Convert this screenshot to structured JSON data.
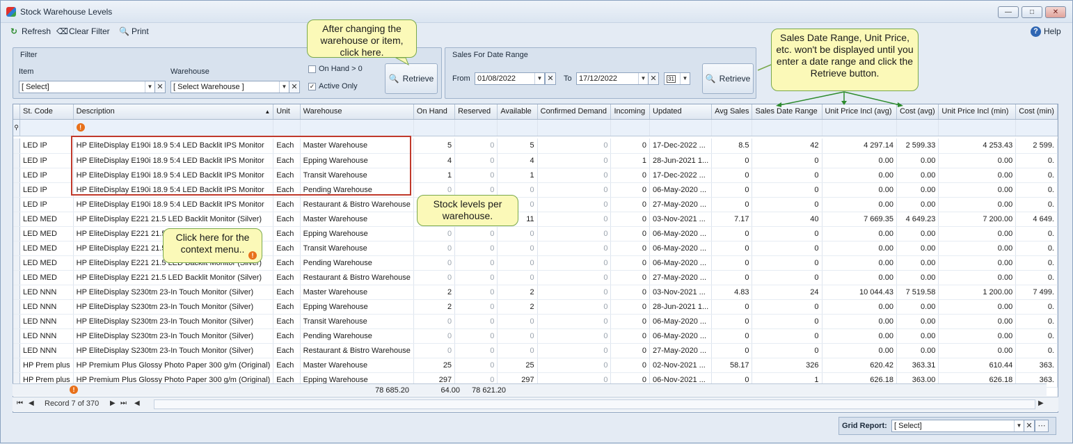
{
  "window": {
    "title": "Stock Warehouse Levels"
  },
  "toolbar": {
    "refresh": "Refresh",
    "clear_filter": "Clear Filter",
    "print": "Print",
    "help": "Help"
  },
  "filter": {
    "title": "Filter",
    "item_label": "Item",
    "item_value": "[ Select]",
    "warehouse_label": "Warehouse",
    "warehouse_value": "[ Select Warehouse ]",
    "on_hand_label": "On Hand > 0",
    "on_hand_checked": false,
    "active_only_label": "Active Only",
    "active_only_checked": true,
    "retrieve": "Retrieve"
  },
  "sales": {
    "title": "Sales For Date Range",
    "from_label": "From",
    "from_value": "01/08/2022",
    "to_label": "To",
    "to_value": "17/12/2022",
    "calendar_label": "31",
    "retrieve": "Retrieve"
  },
  "callouts": {
    "retrieve_hint": "After changing the warehouse or item, click here.",
    "date_hint": "Sales Date Range, Unit Price, etc. won't be displayed until you enter a date range and click the Retrieve button.",
    "stock_hint": "Stock levels per warehouse.",
    "context_hint": "Click here for the context menu.."
  },
  "grid": {
    "columns": [
      "St. Code",
      "Description",
      "Unit",
      "Warehouse",
      "On Hand",
      "Reserved",
      "Available",
      "Confirmed Demand",
      "Incoming",
      "Updated",
      "Avg Sales",
      "Sales Date Range",
      "Unit Price Incl (avg)",
      "Cost (avg)",
      "Unit Price Incl (min)",
      "Cost (min)"
    ],
    "rows": [
      [
        "LED IP",
        "HP EliteDisplay E190i 18.9 5:4 LED Backlit IPS Monitor",
        "Each",
        "Master Warehouse",
        "5",
        "0",
        "5",
        "0",
        "0",
        "17-Dec-2022 ...",
        "8.5",
        "42",
        "4 297.14",
        "2 599.33",
        "4 253.43",
        "2 599."
      ],
      [
        "LED IP",
        "HP EliteDisplay E190i 18.9 5:4 LED Backlit IPS Monitor",
        "Each",
        "Epping Warehouse",
        "4",
        "0",
        "4",
        "0",
        "1",
        "28-Jun-2021 1...",
        "0",
        "0",
        "0.00",
        "0.00",
        "0.00",
        "0."
      ],
      [
        "LED IP",
        "HP EliteDisplay E190i 18.9 5:4 LED Backlit IPS Monitor",
        "Each",
        "Transit Warehouse",
        "1",
        "0",
        "1",
        "0",
        "0",
        "17-Dec-2022 ...",
        "0",
        "0",
        "0.00",
        "0.00",
        "0.00",
        "0."
      ],
      [
        "LED IP",
        "HP EliteDisplay E190i 18.9 5:4 LED Backlit IPS Monitor",
        "Each",
        "Pending Warehouse",
        "0",
        "0",
        "0",
        "0",
        "0",
        "06-May-2020 ...",
        "0",
        "0",
        "0.00",
        "0.00",
        "0.00",
        "0."
      ],
      [
        "LED IP",
        "HP EliteDisplay E190i 18.9 5:4 LED Backlit IPS Monitor",
        "Each",
        "Restaurant & Bistro Warehouse",
        "0",
        "0",
        "0",
        "0",
        "0",
        "27-May-2020 ...",
        "0",
        "0",
        "0.00",
        "0.00",
        "0.00",
        "0."
      ],
      [
        "LED MED",
        "HP EliteDisplay E221 21.5 LED Backlit Monitor (Silver)",
        "Each",
        "Master Warehouse",
        "11",
        "0",
        "11",
        "0",
        "0",
        "03-Nov-2021 ...",
        "7.17",
        "40",
        "7 669.35",
        "4 649.23",
        "7 200.00",
        "4 649."
      ],
      [
        "LED MED",
        "HP EliteDisplay E221 21.5 LED Backlit Monitor (Silver)",
        "Each",
        "Epping Warehouse",
        "0",
        "0",
        "0",
        "0",
        "0",
        "06-May-2020 ...",
        "0",
        "0",
        "0.00",
        "0.00",
        "0.00",
        "0."
      ],
      [
        "LED MED",
        "HP EliteDisplay E221 21.5 LED Backlit Monitor (Silver)",
        "Each",
        "Transit Warehouse",
        "0",
        "0",
        "0",
        "0",
        "0",
        "06-May-2020 ...",
        "0",
        "0",
        "0.00",
        "0.00",
        "0.00",
        "0."
      ],
      [
        "LED MED",
        "HP EliteDisplay E221 21.5 LED Backlit Monitor (Silver)",
        "Each",
        "Pending Warehouse",
        "0",
        "0",
        "0",
        "0",
        "0",
        "06-May-2020 ...",
        "0",
        "0",
        "0.00",
        "0.00",
        "0.00",
        "0."
      ],
      [
        "LED MED",
        "HP EliteDisplay E221 21.5 LED Backlit Monitor (Silver)",
        "Each",
        "Restaurant & Bistro Warehouse",
        "0",
        "0",
        "0",
        "0",
        "0",
        "27-May-2020 ...",
        "0",
        "0",
        "0.00",
        "0.00",
        "0.00",
        "0."
      ],
      [
        "LED NNN",
        "HP EliteDisplay S230tm 23-In Touch Monitor (Silver)",
        "Each",
        "Master Warehouse",
        "2",
        "0",
        "2",
        "0",
        "0",
        "03-Nov-2021 ...",
        "4.83",
        "24",
        "10 044.43",
        "7 519.58",
        "1 200.00",
        "7 499."
      ],
      [
        "LED NNN",
        "HP EliteDisplay S230tm 23-In Touch Monitor (Silver)",
        "Each",
        "Epping Warehouse",
        "2",
        "0",
        "2",
        "0",
        "0",
        "28-Jun-2021 1...",
        "0",
        "0",
        "0.00",
        "0.00",
        "0.00",
        "0."
      ],
      [
        "LED NNN",
        "HP EliteDisplay S230tm 23-In Touch Monitor (Silver)",
        "Each",
        "Transit Warehouse",
        "0",
        "0",
        "0",
        "0",
        "0",
        "06-May-2020 ...",
        "0",
        "0",
        "0.00",
        "0.00",
        "0.00",
        "0."
      ],
      [
        "LED NNN",
        "HP EliteDisplay S230tm 23-In Touch Monitor (Silver)",
        "Each",
        "Pending Warehouse",
        "0",
        "0",
        "0",
        "0",
        "0",
        "06-May-2020 ...",
        "0",
        "0",
        "0.00",
        "0.00",
        "0.00",
        "0."
      ],
      [
        "LED NNN",
        "HP EliteDisplay S230tm 23-In Touch Monitor (Silver)",
        "Each",
        "Restaurant & Bistro Warehouse",
        "0",
        "0",
        "0",
        "0",
        "0",
        "27-May-2020 ...",
        "0",
        "0",
        "0.00",
        "0.00",
        "0.00",
        "0."
      ],
      [
        "HP Prem plus",
        "HP Premium Plus Glossy Photo Paper 300 g/m (Original)",
        "Each",
        "Master Warehouse",
        "25",
        "0",
        "25",
        "0",
        "0",
        "02-Nov-2021 ...",
        "58.17",
        "326",
        "620.42",
        "363.31",
        "610.44",
        "363."
      ],
      [
        "HP Prem plus",
        "HP Premium Plus Glossy Photo Paper 300 g/m (Original)",
        "Each",
        "Epping Warehouse",
        "297",
        "0",
        "297",
        "0",
        "0",
        "06-Nov-2021 ...",
        "0",
        "1",
        "626.18",
        "363.00",
        "626.18",
        "363."
      ]
    ],
    "totals": {
      "on_hand": "78 685.20",
      "reserved": "64.00",
      "available": "78 621.20"
    }
  },
  "navigator": {
    "record": "Record 7 of 370"
  },
  "bottom": {
    "grid_report_label": "Grid Report:",
    "grid_report_value": "[ Select]"
  },
  "colors": {
    "highlight_box": "#c0392b",
    "callout_fill": "#fbf9b8",
    "callout_border": "#79a84b",
    "info_icon": "#e8701a"
  }
}
